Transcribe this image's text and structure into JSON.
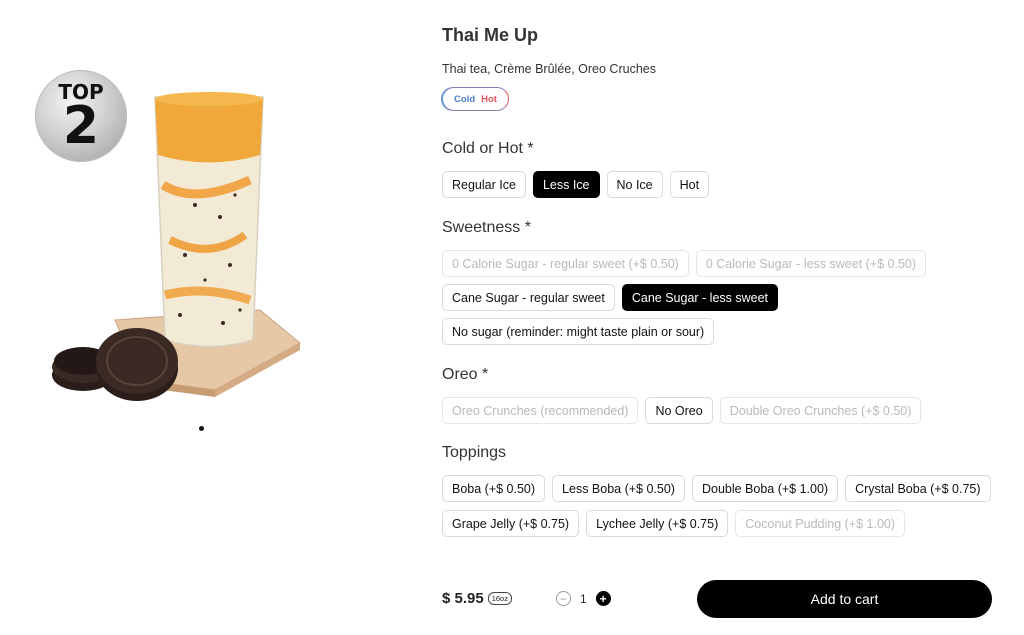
{
  "badge": {
    "top": "TOP",
    "number": "2"
  },
  "product": {
    "title": "Thai Me Up",
    "description": "Thai tea, Crème Brûlée, Oreo Cruches",
    "temp_pill": {
      "cold": "Cold",
      "hot": "Hot",
      "cold_color": "#4a7fc6",
      "hot_color": "#e0545c"
    }
  },
  "sections": {
    "cold_hot": {
      "title": "Cold or Hot *",
      "options": [
        {
          "label": "Regular Ice",
          "state": "normal"
        },
        {
          "label": "Less Ice",
          "state": "selected"
        },
        {
          "label": "No Ice",
          "state": "normal"
        },
        {
          "label": "Hot",
          "state": "normal"
        }
      ]
    },
    "sweetness": {
      "title": "Sweetness *",
      "options": [
        {
          "label": "0 Calorie Sugar - regular sweet (+$ 0.50)",
          "state": "disabled"
        },
        {
          "label": "0 Calorie Sugar - less sweet (+$ 0.50)",
          "state": "disabled"
        },
        {
          "label": "Cane Sugar - regular sweet",
          "state": "normal"
        },
        {
          "label": "Cane Sugar - less sweet",
          "state": "selected"
        },
        {
          "label": "No sugar (reminder: might taste plain or sour)",
          "state": "normal"
        }
      ]
    },
    "oreo": {
      "title": "Oreo *",
      "options": [
        {
          "label": "Oreo Crunches (recommended)",
          "state": "disabled"
        },
        {
          "label": "No Oreo",
          "state": "normal"
        },
        {
          "label": "Double Oreo Crunches (+$ 0.50)",
          "state": "disabled"
        }
      ]
    },
    "toppings": {
      "title": "Toppings",
      "options": [
        {
          "label": "Boba (+$ 0.50)",
          "state": "normal"
        },
        {
          "label": "Less Boba (+$ 0.50)",
          "state": "normal"
        },
        {
          "label": "Double Boba (+$ 1.00)",
          "state": "normal"
        },
        {
          "label": "Crystal Boba (+$ 0.75)",
          "state": "normal"
        },
        {
          "label": "Grape Jelly (+$ 0.75)",
          "state": "normal"
        },
        {
          "label": "Lychee Jelly (+$ 0.75)",
          "state": "normal"
        },
        {
          "label": "Coconut Pudding (+$ 1.00)",
          "state": "disabled"
        }
      ]
    }
  },
  "footer": {
    "price": "$ 5.95",
    "size": "16oz",
    "quantity": "1",
    "minus_icon": "minus-circle-icon",
    "plus_icon": "plus-circle-icon",
    "add_to_cart": "Add to cart"
  }
}
